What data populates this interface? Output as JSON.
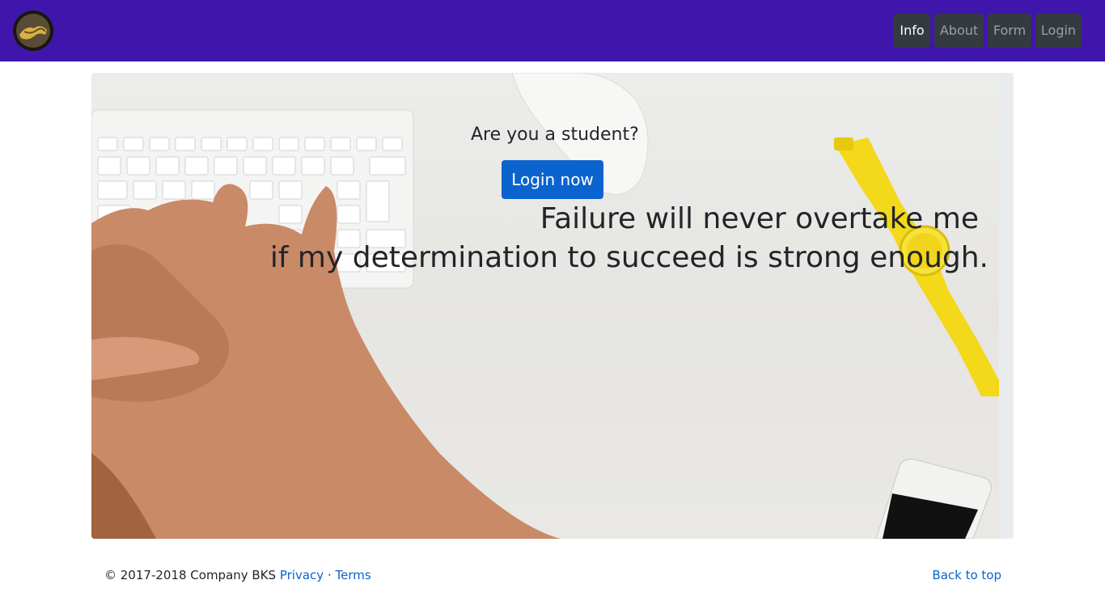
{
  "navbar": {
    "logo_icon": "handshake-logo-icon",
    "background": "#4015ab",
    "items": [
      {
        "label": "Info",
        "active": true
      },
      {
        "label": "About",
        "active": false
      },
      {
        "label": "Form",
        "active": false
      },
      {
        "label": "Login",
        "active": false
      }
    ]
  },
  "hero": {
    "question": "Are you a student?",
    "login_button": "Login now",
    "quote_line1": "Failure will never overtake me",
    "quote_line2": "if my determination to succeed is strong enough.",
    "accent_button_color": "#0b63ce"
  },
  "footer": {
    "copyright": "© 2017-2018 Company BKS",
    "privacy": "Privacy",
    "separator": "·",
    "terms": "Terms",
    "back_to_top": "Back to top"
  }
}
